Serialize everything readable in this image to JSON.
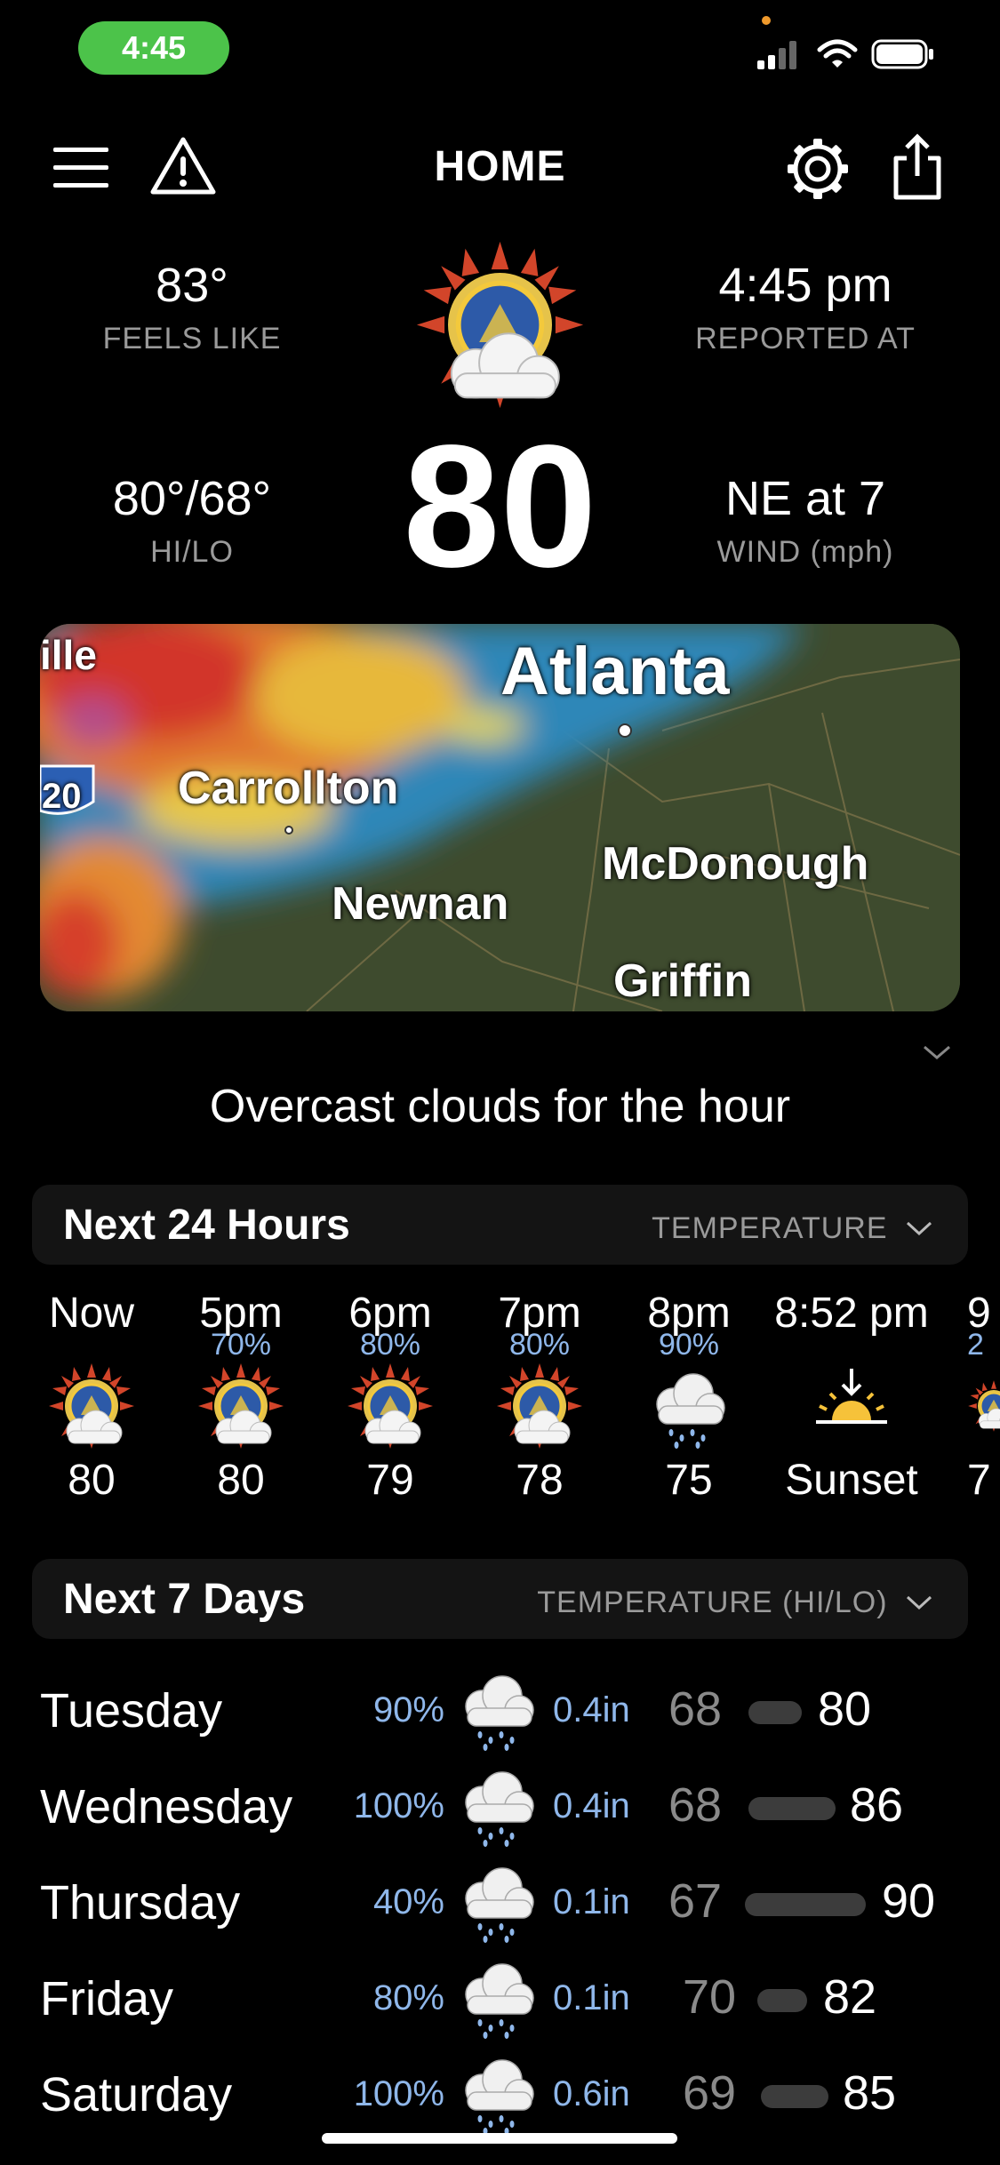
{
  "status_bar": {
    "time": "4:45"
  },
  "header": {
    "title": "HOME",
    "icons": [
      "menu-icon",
      "alert-icon",
      "gear-icon",
      "share-icon"
    ]
  },
  "current": {
    "feels_like": {
      "value": "83°",
      "label": "FEELS LIKE"
    },
    "reported_at": {
      "value": "4:45 pm",
      "label": "REPORTED AT"
    },
    "hi_lo": {
      "value": "80°/68°",
      "label": "HI/LO"
    },
    "temp": "80",
    "wind": {
      "value": "NE at 7",
      "label": "WIND (mph)"
    }
  },
  "map": {
    "labels": {
      "ville": "ille",
      "atlanta": "Atlanta",
      "carrollton": "Carrollton",
      "newnan": "Newnan",
      "mcdonough": "McDonough",
      "griffin": "Griffin",
      "interstate": "20"
    }
  },
  "summary": "Overcast clouds for the hour",
  "hourly": {
    "title": "Next 24 Hours",
    "selector": "TEMPERATURE",
    "items": [
      {
        "time": "Now",
        "precip": "",
        "temp": "80",
        "icon": "sun-cloud-icon"
      },
      {
        "time": "5pm",
        "precip": "70%",
        "temp": "80",
        "icon": "sun-cloud-icon"
      },
      {
        "time": "6pm",
        "precip": "80%",
        "temp": "79",
        "icon": "sun-cloud-icon"
      },
      {
        "time": "7pm",
        "precip": "80%",
        "temp": "78",
        "icon": "sun-cloud-icon"
      },
      {
        "time": "8pm",
        "precip": "90%",
        "temp": "75",
        "icon": "rain-cloud-icon"
      },
      {
        "time": "8:52 pm",
        "precip": "",
        "temp": "Sunset",
        "icon": "sunset-icon"
      },
      {
        "time": "9",
        "precip": "2",
        "temp": "7",
        "icon": "sun-cloud-icon"
      }
    ]
  },
  "daily": {
    "title": "Next 7 Days",
    "selector": "TEMPERATURE (HI/LO)",
    "items": [
      {
        "day": "Tuesday",
        "precip": "90%",
        "amount": "0.4in",
        "lo": "68",
        "hi": "80",
        "icon": "rain-cloud-icon"
      },
      {
        "day": "Wednesday",
        "precip": "100%",
        "amount": "0.4in",
        "lo": "68",
        "hi": "86",
        "icon": "rain-cloud-icon"
      },
      {
        "day": "Thursday",
        "precip": "40%",
        "amount": "0.1in",
        "lo": "67",
        "hi": "90",
        "icon": "rain-cloud-icon"
      },
      {
        "day": "Friday",
        "precip": "80%",
        "amount": "0.1in",
        "lo": "70",
        "hi": "82",
        "icon": "rain-cloud-icon"
      },
      {
        "day": "Saturday",
        "precip": "100%",
        "amount": "0.6in",
        "lo": "69",
        "hi": "85",
        "icon": "rain-cloud-icon"
      }
    ]
  }
}
